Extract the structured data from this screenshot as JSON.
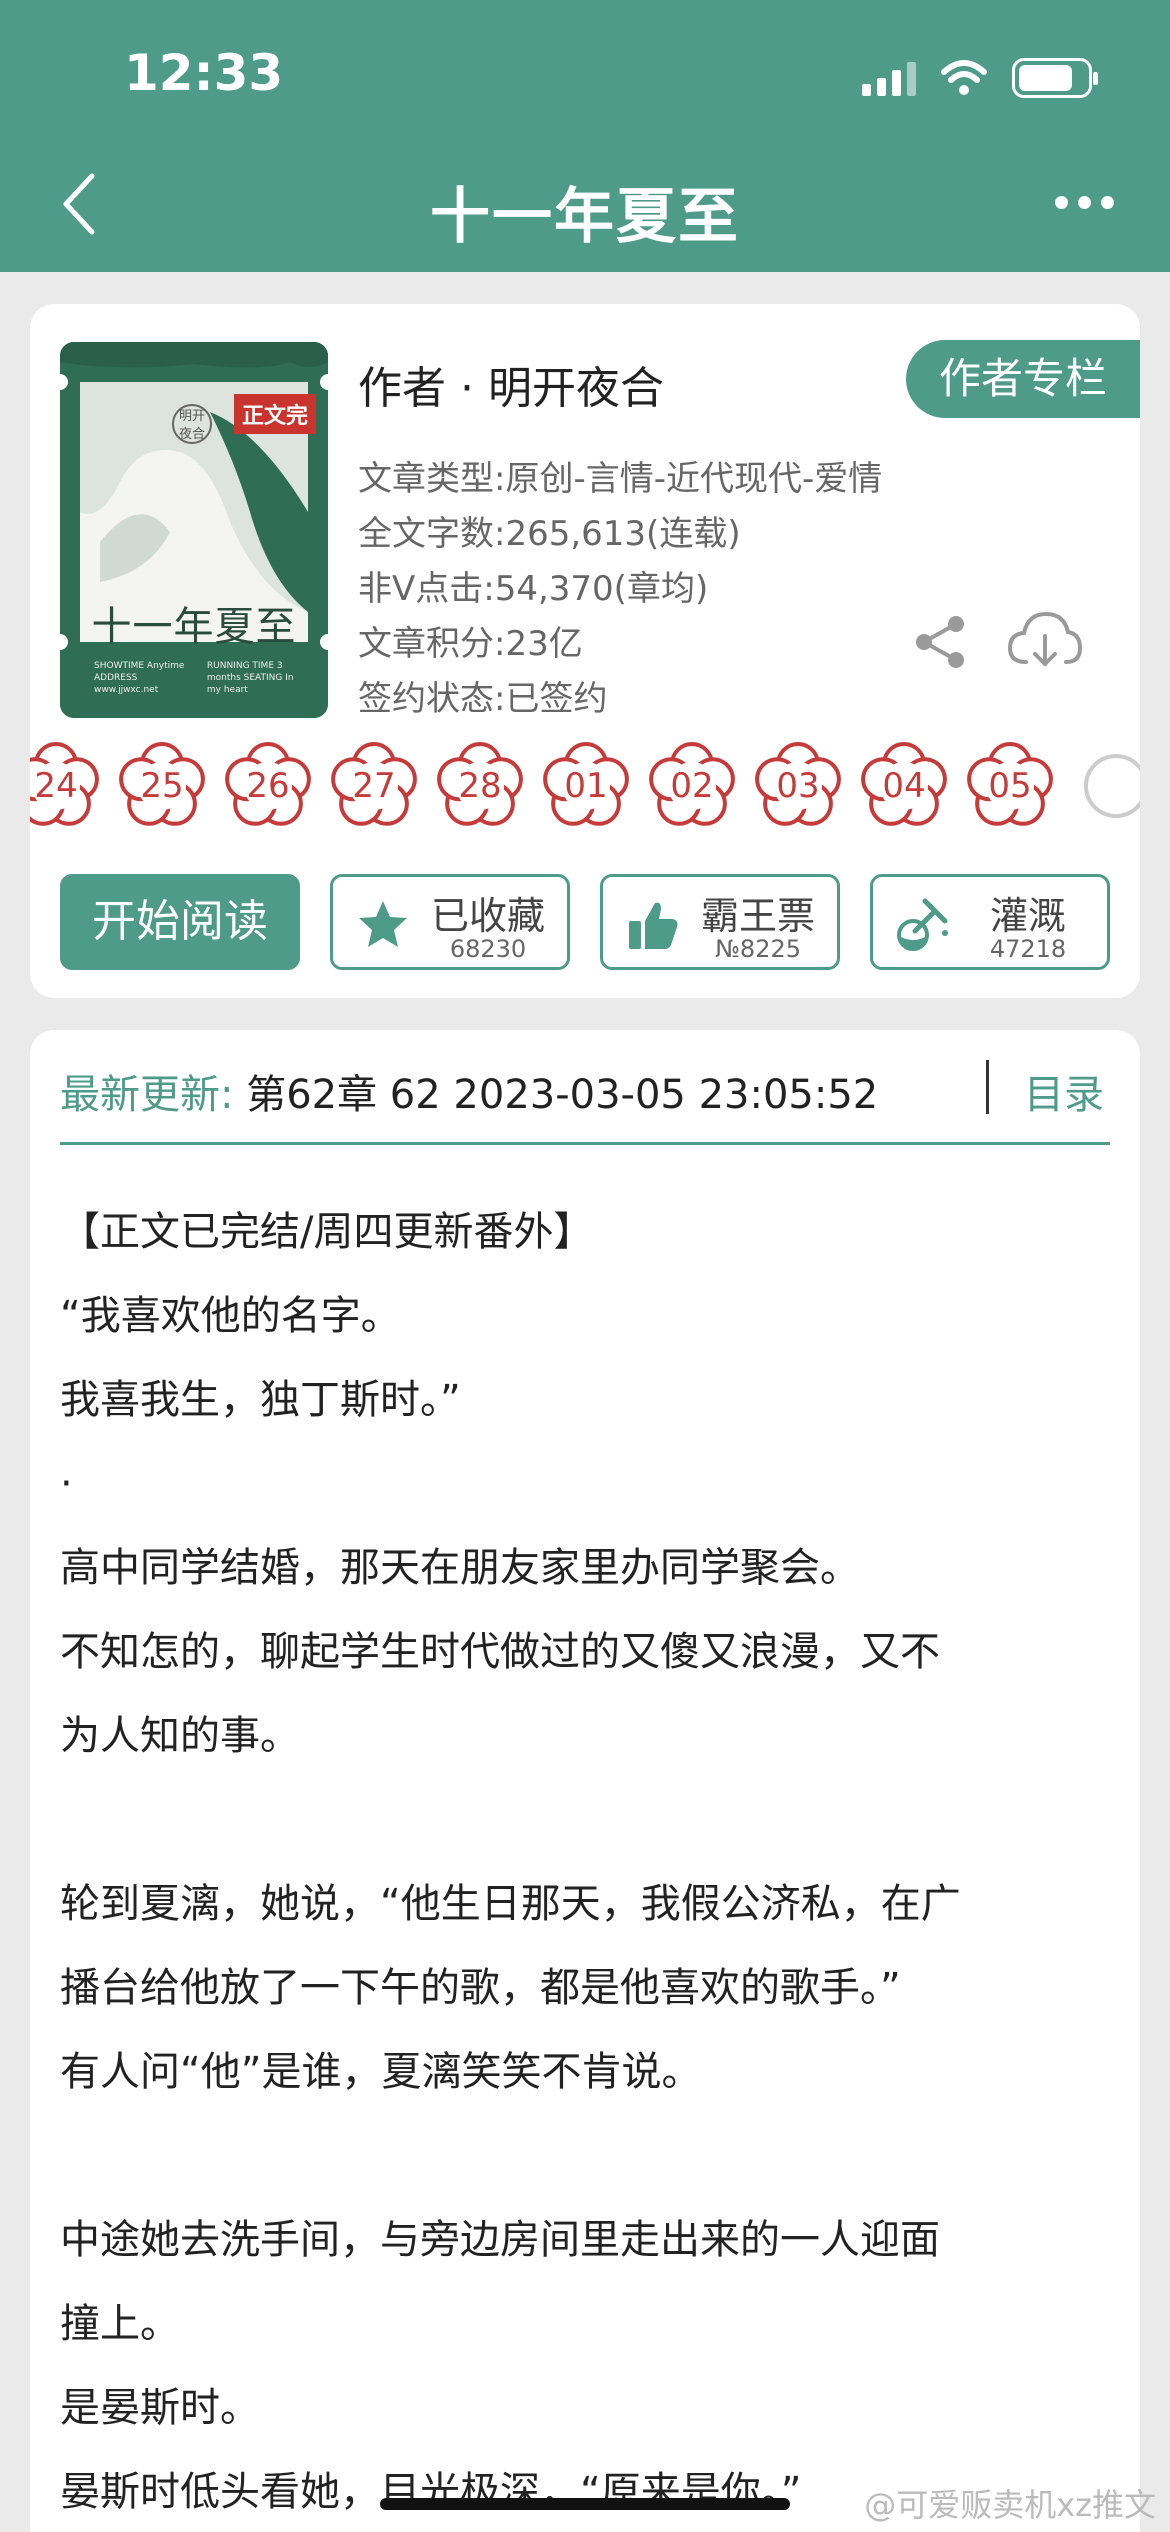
{
  "status_bar": {
    "time": "12:33"
  },
  "nav": {
    "title": "十一年夏至"
  },
  "book": {
    "cover": {
      "badge": "正文完",
      "seal": "明开夜合",
      "title": "十一年夏至",
      "meta_left": "SHOWTIME Anytime ADDRESS www.jjwxc.net",
      "meta_right": "RUNNING TIME 3 months SEATING In my heart"
    },
    "author": "作者 · 明开夜合",
    "author_column_label": "作者专栏",
    "meta": [
      "文章类型:原创-言情-近代现代-爱情",
      "全文字数:265,613(连载)",
      "非V点击:54,370(章均)",
      "文章积分:23亿",
      "签约状态:已签约"
    ],
    "icons": {
      "share": "share-icon",
      "download": "cloud-download-icon"
    },
    "accent_color": "#4e9b8a",
    "flower_color": "#c73a3a",
    "flowers": [
      "24",
      "25",
      "26",
      "27",
      "28",
      "01",
      "02",
      "03",
      "04",
      "05"
    ]
  },
  "actions": {
    "read_label": "开始阅读",
    "favorite": {
      "label": "已收藏",
      "count": "68230",
      "icon": "star-icon"
    },
    "vote": {
      "label": "霸王票",
      "count": "№8225",
      "icon": "thumbs-up-icon"
    },
    "irrigate": {
      "label": "灌溉",
      "count": "47218",
      "icon": "flask-icon"
    }
  },
  "latest": {
    "label": "最新更新:",
    "value": " 第62章 62 2023-03-05 23:05:52",
    "toc_label": "目录"
  },
  "body_paragraphs": [
    "【正文已完结/周四更新番外】",
    "“我喜欢他的名字。",
    "我喜我生，独丁斯时。”",
    "·",
    "高中同学结婚，那天在朋友家里办同学聚会。",
    "不知怎的，聊起学生时代做过的又傻又浪漫，又不",
    "为人知的事。",
    "",
    "轮到夏漓，她说，“他生日那天，我假公济私，在广",
    "播台给他放了一下午的歌，都是他喜欢的歌手。”",
    "有人问“他”是谁，夏漓笑笑不肯说。",
    "",
    "中途她去洗手间，与旁边房间里走出来的一人迎面",
    "撞上。",
    "是晏斯时。",
    "晏斯时低头看她，目光极深，“原来是你。”"
  ],
  "watermark": "@可爱贩卖机xz推文"
}
